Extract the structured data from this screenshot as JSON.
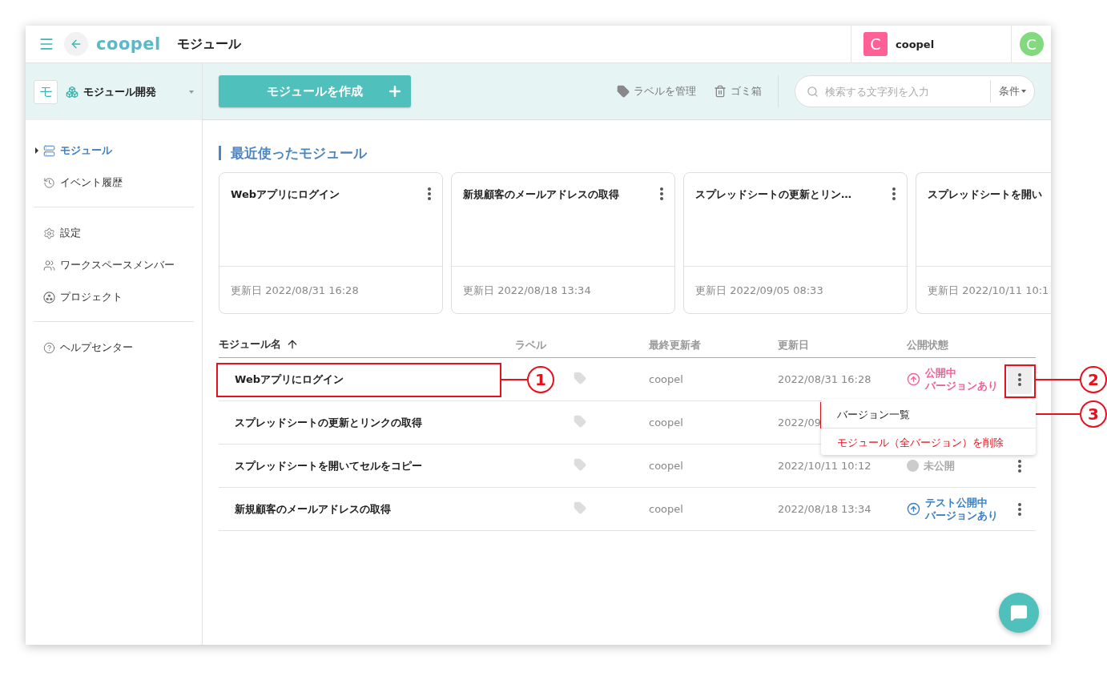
{
  "header": {
    "logo": "coopel",
    "title": "モジュール",
    "workspace_avatar": "C",
    "workspace_name": "coopel",
    "user_avatar": "C"
  },
  "sidebar": {
    "workspace": {
      "icon_letter": "モ",
      "name": "モジュール開発"
    },
    "groups": [
      [
        {
          "label": "モジュール",
          "selected": true
        },
        {
          "label": "イベント履歴",
          "selected": false
        }
      ],
      [
        {
          "label": "設定",
          "selected": false
        },
        {
          "label": "ワークスペースメンバー",
          "selected": false
        },
        {
          "label": "プロジェクト",
          "selected": false
        }
      ],
      [
        {
          "label": "ヘルプセンター",
          "selected": false
        }
      ]
    ]
  },
  "toolbar": {
    "create_button": "モジュールを作成",
    "manage_labels": "ラベルを管理",
    "trash": "ゴミ箱",
    "search": {
      "placeholder": "検索する文字列を入力"
    },
    "filter": "条件"
  },
  "recent": {
    "title": "最近使ったモジュール",
    "cards": [
      {
        "title": "Webアプリにログイン",
        "updated": "更新日 2022/08/31 16:28"
      },
      {
        "title": "新規顧客のメールアドレスの取得",
        "updated": "更新日 2022/08/18 13:34"
      },
      {
        "title": "スプレッドシートの更新とリン…",
        "updated": "更新日 2022/09/05 08:33"
      },
      {
        "title": "スプレッドシートを開い",
        "updated": "更新日 2022/10/11 10:1"
      }
    ]
  },
  "table": {
    "columns": [
      "モジュール名",
      "ラベル",
      "最終更新者",
      "更新日",
      "公開状態"
    ],
    "rows": [
      {
        "name": "Webアプリにログイン",
        "updater": "coopel",
        "date": "2022/08/31 16:28",
        "status": {
          "kind": "published",
          "lines": [
            "公開中",
            "バージョンあり"
          ]
        },
        "menu_open": true
      },
      {
        "name": "スプレッドシートの更新とリンクの取得",
        "updater": "coopel",
        "date": "2022/09",
        "menu_open": false
      },
      {
        "name": "スプレッドシートを開いてセルをコピー",
        "updater": "coopel",
        "date": "2022/10/11 10:12",
        "status": {
          "kind": "unpublished",
          "lines": [
            "未公開"
          ]
        },
        "menu_open": false
      },
      {
        "name": "新規顧客のメールアドレスの取得",
        "updater": "coopel",
        "date": "2022/08/18 13:34",
        "status": {
          "kind": "test",
          "lines": [
            "テスト公開中",
            "バージョンあり"
          ]
        },
        "menu_open": false
      }
    ]
  },
  "context_menu": [
    {
      "label": "バージョン一覧",
      "kind": "normal"
    },
    {
      "label": "モジュール（全バージョン）を削除",
      "kind": "danger"
    }
  ],
  "annotations": [
    "1",
    "2",
    "3"
  ]
}
